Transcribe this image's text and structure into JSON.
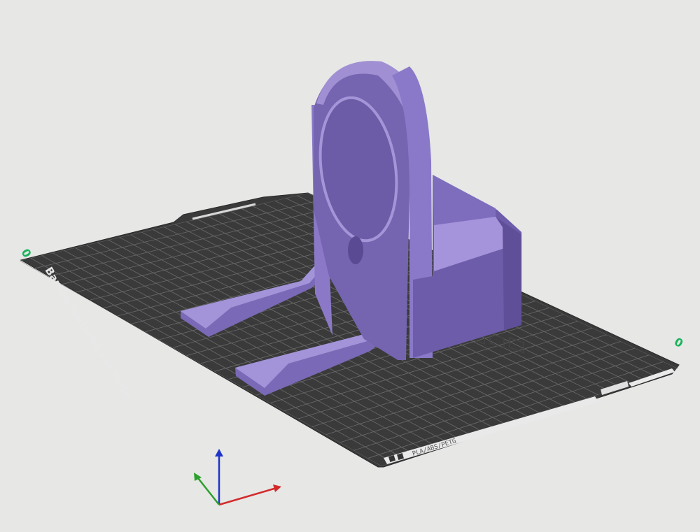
{
  "plate": {
    "name": "Bambu Textured PEI Plate",
    "filament_types": "PLA/ABS/PETG",
    "corner_left": "0",
    "corner_right": "0"
  },
  "axes": {
    "x_color": "#d22a2a",
    "y_color": "#2ca02c",
    "z_color": "#1f35c8"
  },
  "model": {
    "color": "#a08fd3"
  },
  "colors": {
    "background": "#e7e7e6",
    "plate": "#3b3b3b",
    "grid": "#7a7a7a"
  }
}
